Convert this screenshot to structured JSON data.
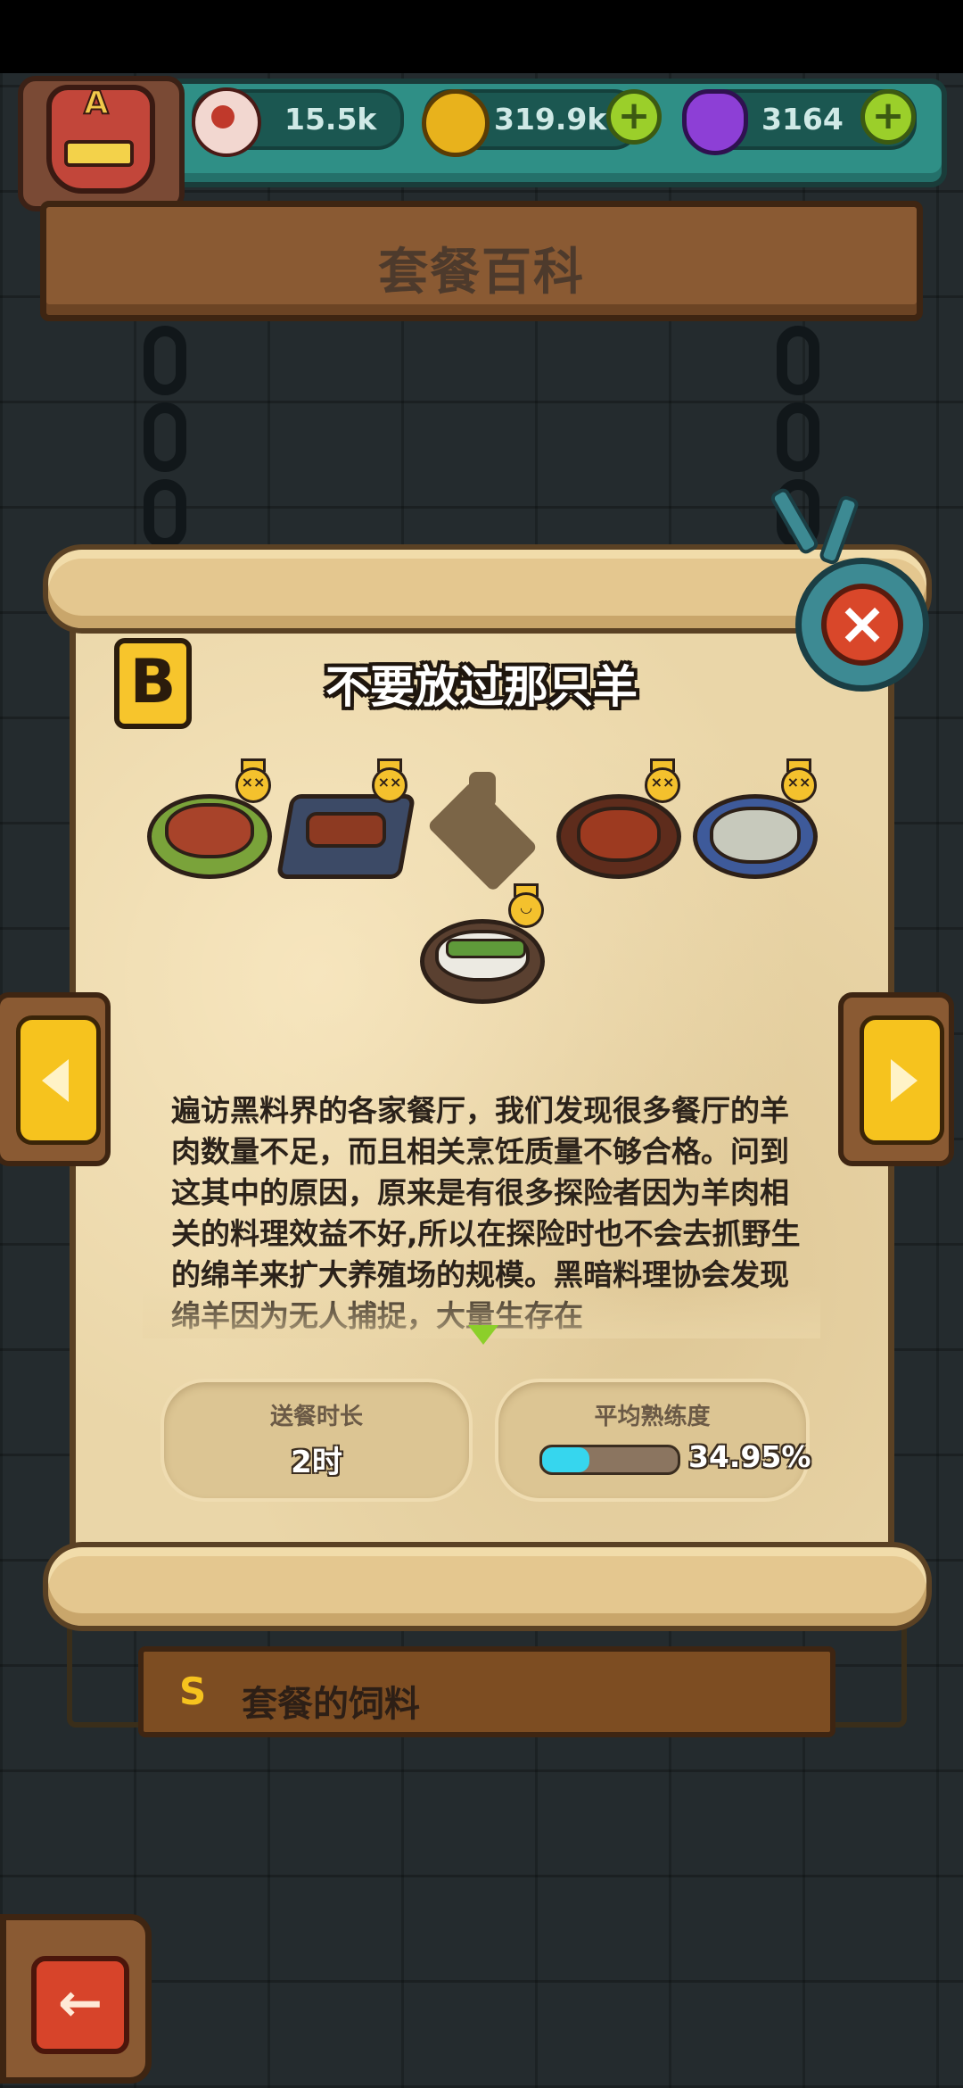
{
  "header": {
    "avatar_letter": "A",
    "resources": [
      {
        "name": "eyeball",
        "icon": "eyeball-icon",
        "value": "15.5k"
      },
      {
        "name": "coin",
        "icon": "coin-icon",
        "value": "319.9k"
      },
      {
        "name": "potion",
        "icon": "potion-icon",
        "value": "3164"
      }
    ]
  },
  "page": {
    "title": "套餐百科"
  },
  "combo": {
    "grade": "B",
    "title": "不要放过那只羊",
    "dishes": [
      {
        "icon": "roast-lamb-dish-icon",
        "locked": false
      },
      {
        "icon": "lamb-skewers-dish-icon",
        "locked": false
      },
      {
        "icon": "locked-dish-silhouette-icon",
        "locked": true
      },
      {
        "icon": "braised-lamb-dish-icon",
        "locked": false
      },
      {
        "icon": "lamb-soup-dish-icon",
        "locked": false
      },
      {
        "icon": "lamb-asparagus-dish-icon",
        "locked": false
      }
    ],
    "description": "遍访黑料界的各家餐厅，我们发现很多餐厅的羊肉数量不足，而且相关烹饪质量不够合格。问到这其中的原因，原来是有很多探险者因为羊肉相关的料理效益不好,所以在探险时也不会去抓野生的绵羊来扩大养殖场的规模。黑暗料理协会发现绵羊因为无人捕捉，大量生存在",
    "stats": {
      "delivery_label": "送餐时长",
      "delivery_value": "2时",
      "mastery_label": "平均熟练度",
      "mastery_value": "34.95%",
      "mastery_fraction": 0.3495
    }
  },
  "next_plank": {
    "grade": "S",
    "text": "套餐的饲料"
  },
  "colors": {
    "accent_yellow": "#f6c31e",
    "teal": "#2f8f86",
    "close_red": "#d9472a",
    "progress_cyan": "#36d6ee"
  }
}
